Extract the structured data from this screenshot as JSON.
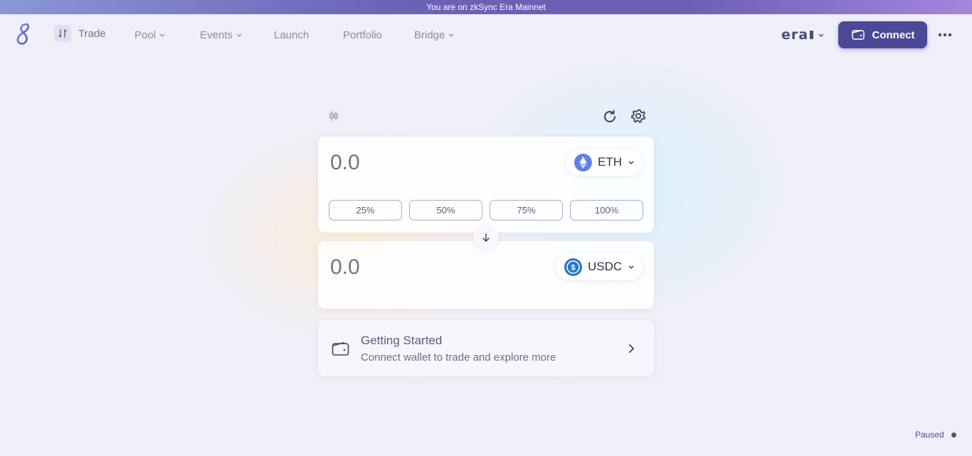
{
  "banner": {
    "text": "You are on zkSync Era Mainnet"
  },
  "nav": {
    "trade": "Trade",
    "pool": "Pool",
    "events": "Events",
    "launch": "Launch",
    "portfolio": "Portfolio",
    "bridge": "Bridge"
  },
  "header": {
    "network": "era",
    "connect_label": "Connect"
  },
  "swap": {
    "from": {
      "amount_placeholder": "0.0",
      "token": "ETH"
    },
    "percent_buttons": [
      "25%",
      "50%",
      "75%",
      "100%"
    ],
    "to": {
      "amount_placeholder": "0.0",
      "token": "USDC"
    }
  },
  "getting_started": {
    "title": "Getting Started",
    "subtitle": "Connect wallet to trade and explore more"
  },
  "status": {
    "label": "Paused"
  },
  "colors": {
    "accent": "#4b4895",
    "eth": "#627eea",
    "usdc": "#2775ca"
  }
}
